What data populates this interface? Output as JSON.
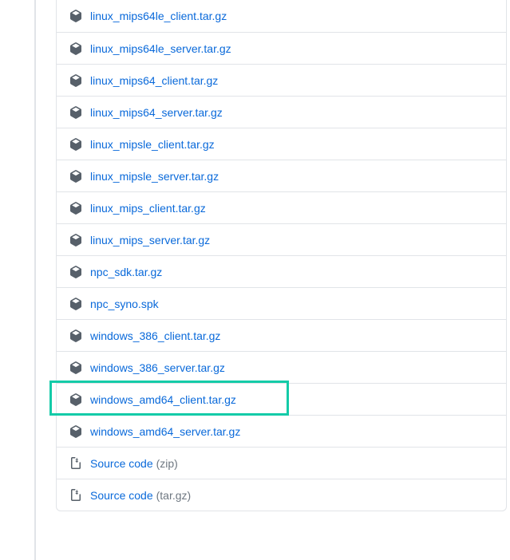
{
  "assets": {
    "items": [
      {
        "type": "package",
        "name": "linux_mips64le_client.tar.gz"
      },
      {
        "type": "package",
        "name": "linux_mips64le_server.tar.gz"
      },
      {
        "type": "package",
        "name": "linux_mips64_client.tar.gz"
      },
      {
        "type": "package",
        "name": "linux_mips64_server.tar.gz"
      },
      {
        "type": "package",
        "name": "linux_mipsle_client.tar.gz"
      },
      {
        "type": "package",
        "name": "linux_mipsle_server.tar.gz"
      },
      {
        "type": "package",
        "name": "linux_mips_client.tar.gz"
      },
      {
        "type": "package",
        "name": "linux_mips_server.tar.gz"
      },
      {
        "type": "package",
        "name": "npc_sdk.tar.gz"
      },
      {
        "type": "package",
        "name": "npc_syno.spk"
      },
      {
        "type": "package",
        "name": "windows_386_client.tar.gz"
      },
      {
        "type": "package",
        "name": "windows_386_server.tar.gz"
      },
      {
        "type": "package",
        "name": "windows_amd64_client.tar.gz",
        "highlighted": true
      },
      {
        "type": "package",
        "name": "windows_amd64_server.tar.gz"
      },
      {
        "type": "zip",
        "name": "Source code",
        "format": "(zip)"
      },
      {
        "type": "zip",
        "name": "Source code",
        "format": "(tar.gz)"
      }
    ]
  },
  "highlight_color": "#14cba8"
}
